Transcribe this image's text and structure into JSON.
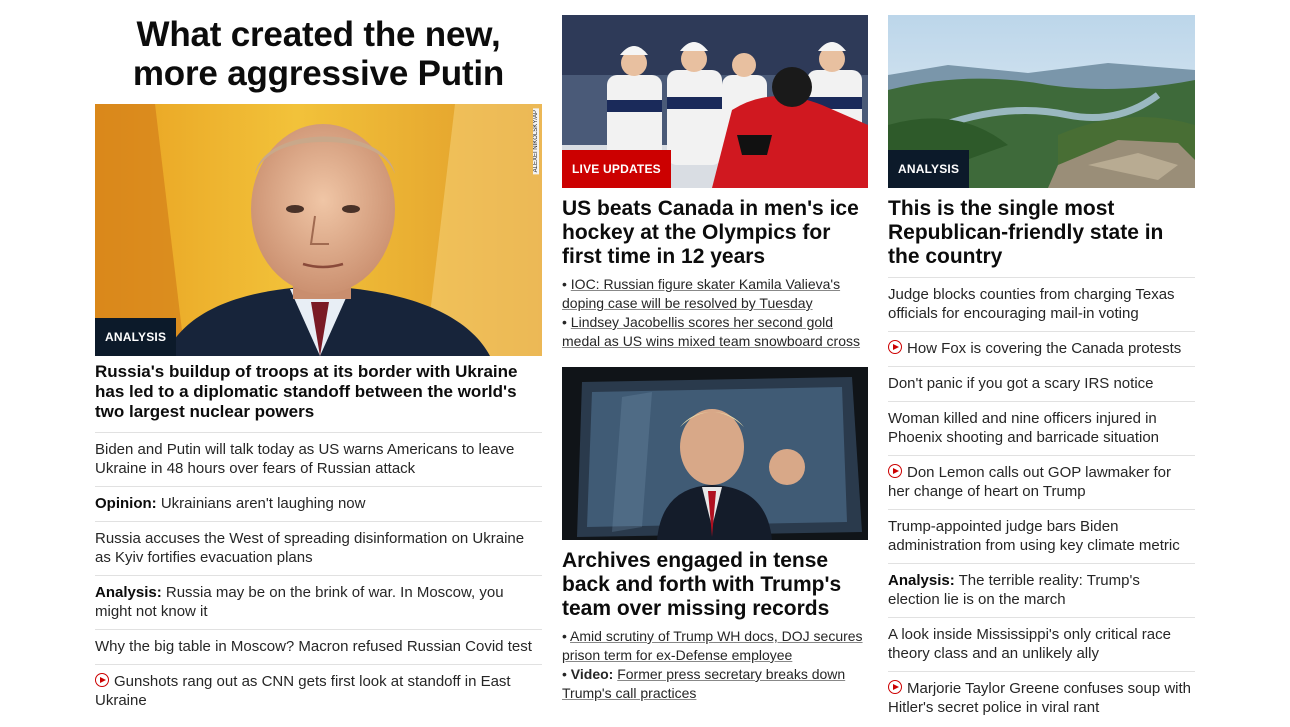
{
  "col1": {
    "title": "What created the new, more aggressive Putin",
    "badge": "ANALYSIS",
    "credit": "ALEXEI NIKOLSKY/AP",
    "lead": "Russia's buildup of troops at its border with Ukraine has led to a diplomatic standoff between the world's two largest nuclear powers",
    "stories": [
      {
        "prefix": "",
        "text": "Biden and Putin will talk today as US warns Americans to leave Ukraine in 48 hours over fears of Russian attack",
        "video": false
      },
      {
        "prefix": "Opinion:",
        "text": " Ukrainians aren't laughing now",
        "video": false
      },
      {
        "prefix": "",
        "text": "Russia accuses the West of spreading disinformation on Ukraine as Kyiv fortifies evacuation plans",
        "video": false
      },
      {
        "prefix": "Analysis:",
        "text": " Russia may be on the brink of war. In Moscow, you might not know it",
        "video": false
      },
      {
        "prefix": "",
        "text": "Why the big table in Moscow? Macron refused Russian Covid test",
        "video": false
      },
      {
        "prefix": "",
        "text": "Gunshots rang out as CNN gets first look at standoff in East Ukraine",
        "video": true
      }
    ]
  },
  "col2": {
    "top": {
      "badge": "LIVE UPDATES",
      "headline": "US beats Canada in men's ice hockey at the Olympics for first time in 12 years",
      "subs": [
        {
          "prefix": "",
          "text": "IOC: Russian figure skater Kamila Valieva's doping case will be resolved by Tuesday"
        },
        {
          "prefix": "",
          "text": "Lindsey Jacobellis scores her second gold medal as US wins mixed team snowboard cross"
        }
      ]
    },
    "bottom": {
      "headline": "Archives engaged in tense back and forth with Trump's team over missing records",
      "subs": [
        {
          "prefix": "",
          "text": "Amid scrutiny of Trump WH docs, DOJ secures prison term for ex-Defense employee"
        },
        {
          "prefix": "Video:",
          "text": "Former press secretary breaks down Trump's call practices"
        }
      ]
    }
  },
  "col3": {
    "badge": "ANALYSIS",
    "headline": "This is the single most Republican-friendly state in the country",
    "stories": [
      {
        "prefix": "",
        "text": "Judge blocks counties from charging Texas officials for encouraging mail-in voting",
        "video": false
      },
      {
        "prefix": "",
        "text": "How Fox is covering the Canada protests",
        "video": true
      },
      {
        "prefix": "",
        "text": "Don't panic if you got a scary IRS notice",
        "video": false
      },
      {
        "prefix": "",
        "text": "Woman killed and nine officers injured in Phoenix shooting and barricade situation",
        "video": false
      },
      {
        "prefix": "",
        "text": "Don Lemon calls out GOP lawmaker for her change of heart on Trump",
        "video": true
      },
      {
        "prefix": "",
        "text": "Trump-appointed judge bars Biden administration from using key climate metric",
        "video": false
      },
      {
        "prefix": "Analysis:",
        "text": " The terrible reality: Trump's election lie is on the march",
        "video": false
      },
      {
        "prefix": "",
        "text": "A look inside Mississippi's only critical race theory class and an unlikely ally",
        "video": false
      },
      {
        "prefix": "",
        "text": "Marjorie Taylor Greene confuses soup with Hitler's secret police in viral rant",
        "video": true
      }
    ]
  },
  "colors": {
    "red": "#cc0000",
    "navy": "#0c1a2a",
    "text": "#0c0c0c",
    "divider": "#e1e1e1"
  }
}
